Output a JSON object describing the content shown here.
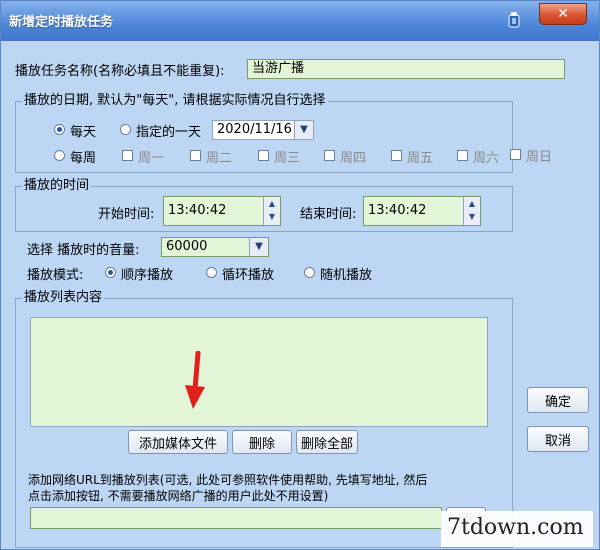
{
  "window": {
    "title": "新增定时播放任务",
    "close_label": "✕"
  },
  "task_name": {
    "label": "播放任务名称(名称必填且不能重复):",
    "value": "当游广播"
  },
  "date_group": {
    "title": "播放的日期, 默认为\"每天\", 请根据实际情况自行选择",
    "daily": "每天",
    "specific_day": "指定的一天",
    "date_value": "2020/11/16",
    "weekly": "每周",
    "weekdays": [
      "周一",
      "周二",
      "周三",
      "周四",
      "周五",
      "周六",
      "周日"
    ]
  },
  "time_group": {
    "title": "播放的时间",
    "start_label": "开始时间:",
    "start_value": "13:40:42",
    "end_label": "结束时间:",
    "end_value": "13:40:42"
  },
  "volume": {
    "label": "选择 播放时的音量:",
    "value": "60000"
  },
  "mode": {
    "label": "播放模式:",
    "options": [
      "顺序播放",
      "循环播放",
      "随机播放"
    ]
  },
  "playlist": {
    "title": "播放列表内容",
    "add_media": "添加媒体文件",
    "delete": "删除",
    "delete_all": "删除全部",
    "url_hint_line1": "添加网络URL到播放列表(可选, 此处可参照软件使用帮助, 先填写地址, 然后",
    "url_hint_line2": "点击添加按钮, 不需要播放网络广播的用户此处不用设置)",
    "url_button": "添"
  },
  "buttons": {
    "ok": "确定",
    "cancel": "取消"
  },
  "watermark": "7tdown.com"
}
